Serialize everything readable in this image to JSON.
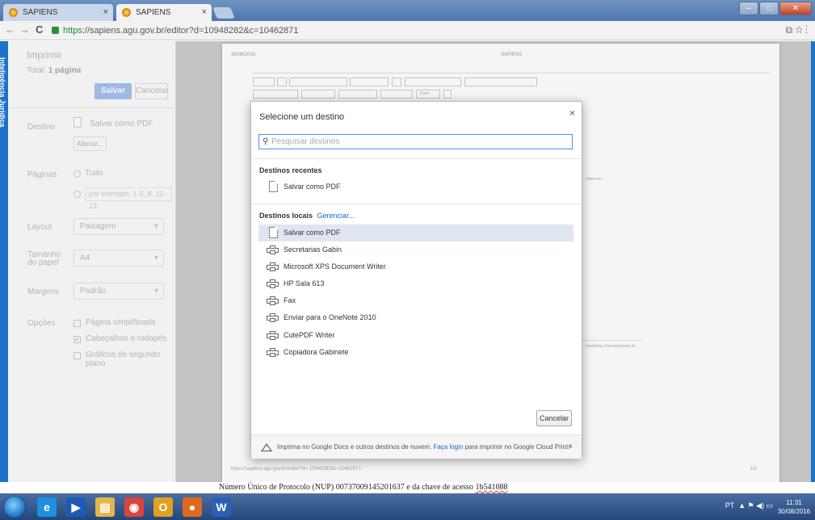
{
  "window": {
    "tabs": [
      {
        "label": "SAPIENS",
        "close": "×"
      },
      {
        "label": "SAPIENS",
        "close": "×"
      }
    ],
    "controls": {
      "minimize": "–",
      "maximize": "□",
      "close": "✕"
    }
  },
  "toolbar": {
    "back": "←",
    "forward": "→",
    "reload": "C",
    "url_scheme": "https",
    "url_rest": "://sapiens.agu.gov.br/editor?d=10948282&c=10462871",
    "icons": "⧉☆⋮"
  },
  "sidebar": {
    "label": "Inteligência Jurídica"
  },
  "print_panel": {
    "title": "Imprimir",
    "total_label": "Total:",
    "total_value": "1 página",
    "save": "Salvar",
    "cancel": "Cancelar",
    "destination_label": "Destino",
    "destination_value": "Salvar como PDF",
    "change": "Alterar...",
    "pages_label": "Páginas",
    "pages_all": "Tudo",
    "pages_placeholder": "por exemplo, 1-5, 8, 11-13",
    "layout_label": "Layout",
    "layout_value": "Paisagem",
    "paper_label": "Tamanho do papel",
    "paper_value": "A4",
    "margins_label": "Margens",
    "margins_value": "Padrão",
    "options_label": "Opções",
    "opt_simplified": "Página simplificada",
    "opt_headers": "Cabeçalhos e rodapés",
    "opt_background": "Gráficos de segundo plano"
  },
  "document": {
    "date": "30/08/2016",
    "header": "SAPIENS",
    "footer_url": "https://sapiens.agu.gov.br/editor?d= 10948282&c=10462871",
    "page_num": "1/1",
    "zoom": "Zoom",
    "snippet1": "nteira-mi...",
    "snippet2": "mediante o fornecimento do"
  },
  "nup_text": "Número Único de Protocolo (NUP) 00737009145201637 e da chave de acesso ",
  "nup_key": "1b541088",
  "dialog": {
    "title": "Selecione um destino",
    "close": "×",
    "search_icon": "magnifier-icon",
    "search_placeholder": "Pesquisar destinos",
    "recent_title": "Destinos recentes",
    "recent": [
      {
        "label": "Salvar como PDF",
        "icon": "pdf-icon"
      }
    ],
    "local_title": "Destinos locais",
    "manage": "Gerenciar...",
    "local": [
      {
        "label": "Salvar como PDF",
        "icon": "pdf-icon",
        "selected": true
      },
      {
        "label": "Secretarias Gabin",
        "icon": "printer-icon"
      },
      {
        "label": "Microsoft XPS Document Writer",
        "icon": "printer-icon"
      },
      {
        "label": "HP Sala 613",
        "icon": "printer-icon"
      },
      {
        "label": "Fax",
        "icon": "printer-icon"
      },
      {
        "label": "Enviar para o OneNote 2010",
        "icon": "printer-icon"
      },
      {
        "label": "CutePDF Writer",
        "icon": "printer-icon"
      },
      {
        "label": "Copiadora Gabinete",
        "icon": "printer-icon"
      }
    ],
    "cancel": "Cancelar",
    "footer_text": "Imprima no Google Docs e outros destinos de nuvem. ",
    "footer_link": "Faça login",
    "footer_text2": " para imprimir no Google Cloud Print.",
    "footer_close": "×"
  },
  "taskbar": {
    "apps": [
      {
        "name": "internet-explorer",
        "glyph": "e",
        "color": "#1f8fe0"
      },
      {
        "name": "media-player",
        "glyph": "▶",
        "color": "#1d5ab3"
      },
      {
        "name": "file-explorer",
        "glyph": "▤",
        "color": "#e3b84a"
      },
      {
        "name": "chrome",
        "glyph": "◉",
        "color": "#d9453a"
      },
      {
        "name": "outlook",
        "glyph": "O",
        "color": "#e0a020"
      },
      {
        "name": "firefox",
        "glyph": "●",
        "color": "#e06a1b"
      },
      {
        "name": "word",
        "glyph": "W",
        "color": "#2b5fb3"
      }
    ],
    "lang": "PT",
    "time": "11:31",
    "date": "30/08/2016"
  }
}
